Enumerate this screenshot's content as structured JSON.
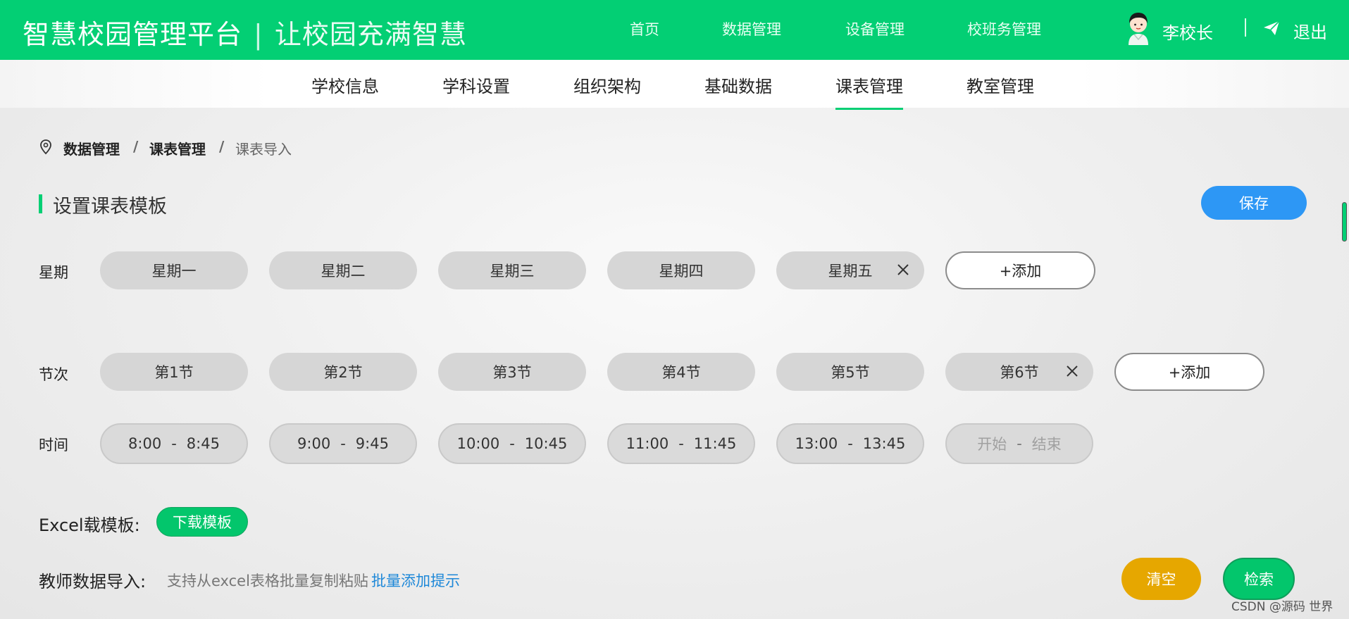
{
  "header": {
    "app_title": "智慧校园管理平台",
    "separator": "|",
    "slogan": "让校园充满智慧",
    "nav": [
      "首页",
      "数据管理",
      "设备管理",
      "校班务管理"
    ],
    "user_name": "李校长",
    "logout_label": "退出",
    "brand_color": "#03cf74"
  },
  "subnav": {
    "tabs": [
      "学校信息",
      "学科设置",
      "组织架构",
      "基础数据",
      "课表管理",
      "教室管理"
    ],
    "active": "课表管理"
  },
  "breadcrumb": {
    "items": [
      "数据管理",
      "课表管理",
      "课表导入"
    ],
    "separator": "/"
  },
  "section": {
    "title": "设置课表模板",
    "save_label": "保存"
  },
  "weekdays": {
    "label": "星期",
    "items": [
      "星期一",
      "星期二",
      "星期三",
      "星期四",
      "星期五"
    ],
    "add_label": "+添加"
  },
  "periods": {
    "label": "节次",
    "items": [
      "第1节",
      "第2节",
      "第3节",
      "第4节",
      "第5节",
      "第6节"
    ],
    "add_label": "+添加"
  },
  "times": {
    "label": "时间",
    "dash": "-",
    "items": [
      {
        "start": "8:00",
        "end": "8:45"
      },
      {
        "start": "9:00",
        "end": "9:45"
      },
      {
        "start": "10:00",
        "end": "10:45"
      },
      {
        "start": "11:00",
        "end": "11:45"
      },
      {
        "start": "13:00",
        "end": "13:45"
      }
    ],
    "empty": {
      "start_placeholder": "开始",
      "end_placeholder": "结束"
    }
  },
  "excel": {
    "label": "Excel载模板:",
    "download_label": "下载模板"
  },
  "import": {
    "label": "教师数据导入:",
    "hint": "支持从excel表格批量复制粘贴",
    "link": "批量添加提示",
    "clear_label": "清空",
    "search_label": "检索"
  },
  "watermark": "CSDN @源码 世界",
  "colors": {
    "accent": "#03cf74",
    "save": "#2d97f5",
    "clear": "#e6a700",
    "link": "#1e88d8"
  }
}
